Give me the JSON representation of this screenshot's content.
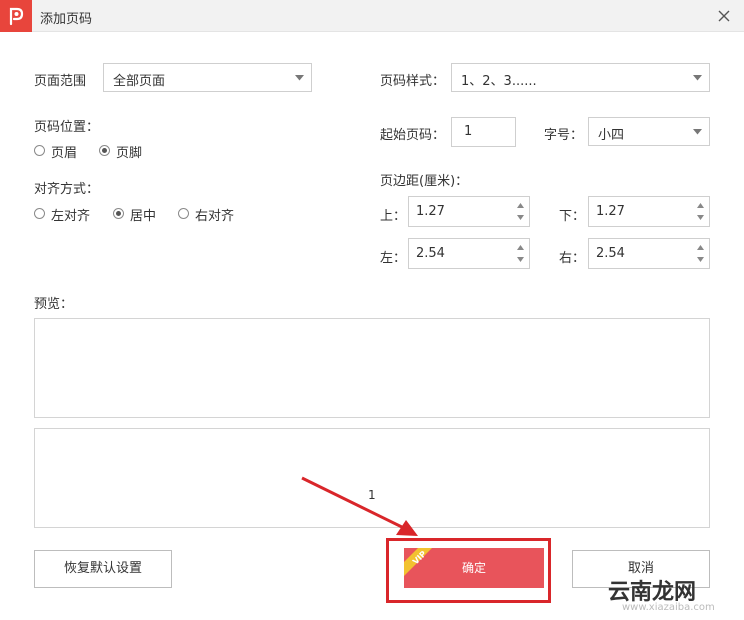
{
  "window": {
    "title": "添加页码"
  },
  "page_range": {
    "label": "页面范围",
    "value": "全部页面"
  },
  "page_number_style": {
    "label": "页码样式：",
    "value": "1、2、3......"
  },
  "position": {
    "label": "页码位置：",
    "options": [
      {
        "label": "页眉",
        "checked": false
      },
      {
        "label": "页脚",
        "checked": true
      }
    ]
  },
  "start_page": {
    "label": "起始页码：",
    "value": "1"
  },
  "font_size": {
    "label": "字号：",
    "value": "小四"
  },
  "alignment": {
    "label": "对齐方式：",
    "options": [
      {
        "label": "左对齐",
        "checked": false
      },
      {
        "label": "居中",
        "checked": true
      },
      {
        "label": "右对齐",
        "checked": false
      }
    ]
  },
  "margins": {
    "label": "页边距(厘米)：",
    "top": {
      "label": "上：",
      "value": "1.27"
    },
    "bottom": {
      "label": "下：",
      "value": "1.27"
    },
    "left": {
      "label": "左：",
      "value": "2.54"
    },
    "right": {
      "label": "右：",
      "value": "2.54"
    }
  },
  "preview": {
    "label": "预览：",
    "page_number": "1"
  },
  "buttons": {
    "restore": "恢复默认设置",
    "confirm": "确定",
    "cancel": "取消",
    "vip": "VIP"
  },
  "watermark": {
    "main": "云南龙网",
    "sub": "www.xiazaiba.com"
  },
  "colors": {
    "accent": "#e8453c",
    "confirm": "#e8545b",
    "highlight": "#d9262a"
  }
}
